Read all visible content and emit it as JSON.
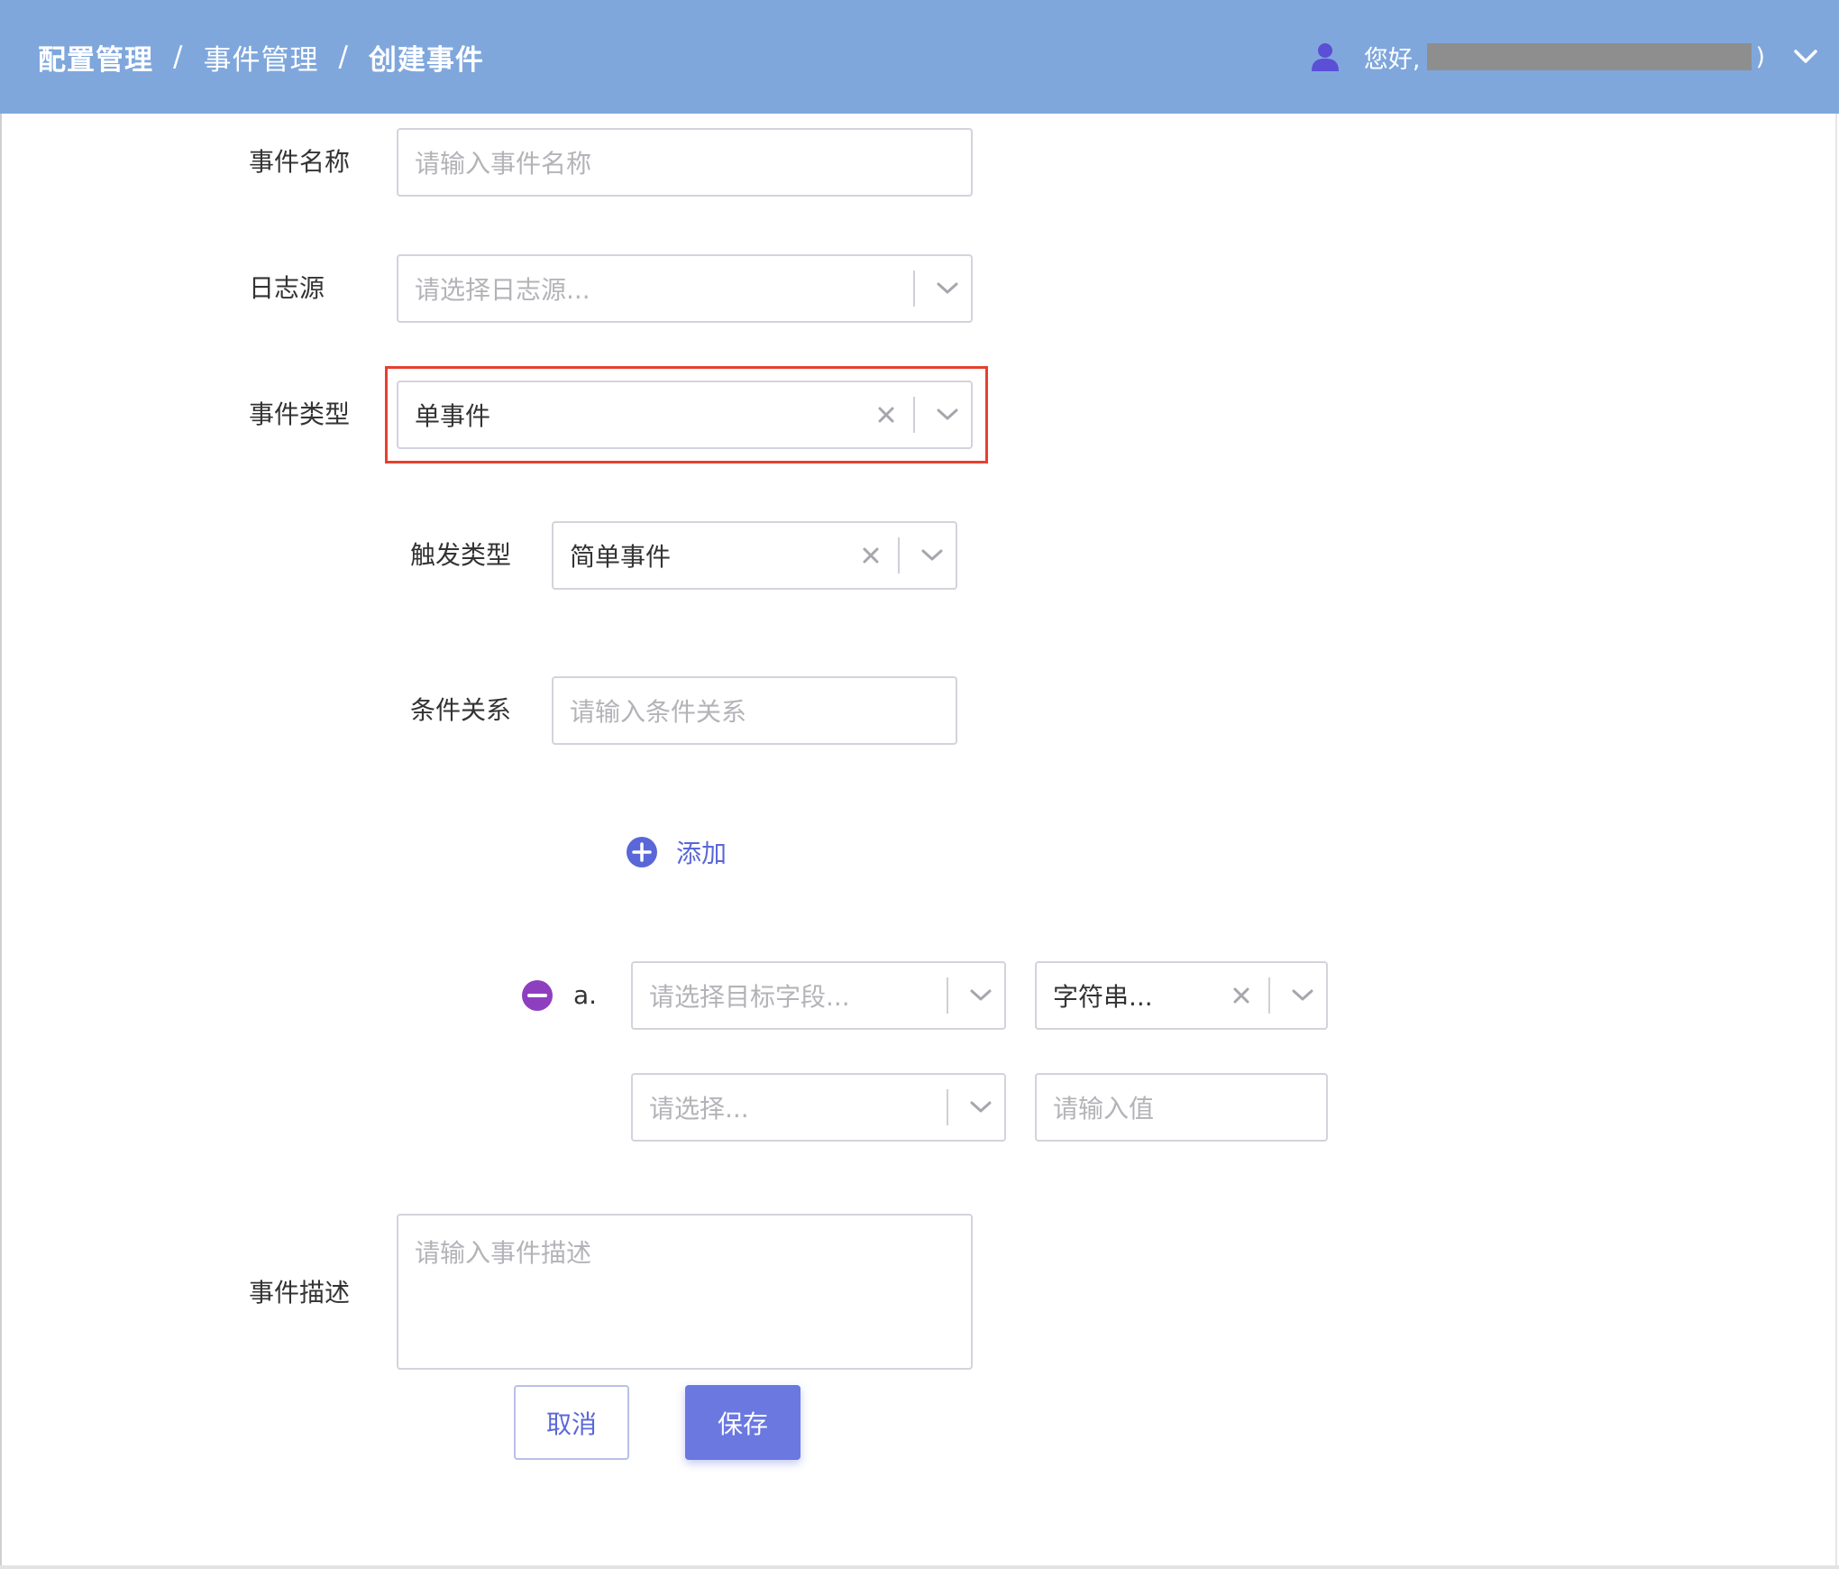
{
  "header": {
    "breadcrumb": [
      "配置管理",
      "事件管理",
      "创建事件"
    ],
    "separator": "/",
    "greeting": "您好,",
    "paren_close": ")",
    "user_icon": "user-icon",
    "menu_icon": "chevron-down-icon"
  },
  "form": {
    "event_name": {
      "label": "事件名称",
      "placeholder": "请输入事件名称"
    },
    "log_source": {
      "label": "日志源",
      "placeholder": "请选择日志源..."
    },
    "event_type": {
      "label": "事件类型",
      "value": "单事件"
    },
    "trigger_type": {
      "label": "触发类型",
      "value": "简单事件"
    },
    "condition_relation": {
      "label": "条件关系",
      "placeholder": "请输入条件关系"
    },
    "add_label": "添加",
    "condition": {
      "index": "a.",
      "target_field_placeholder": "请选择目标字段...",
      "data_type_value": "字符串...",
      "operator_placeholder": "请选择...",
      "value_placeholder": "请输入值"
    },
    "description": {
      "label": "事件描述",
      "placeholder": "请输入事件描述"
    }
  },
  "actions": {
    "cancel": "取消",
    "save": "保存"
  },
  "colors": {
    "header_bg": "#7fa7dc",
    "accent": "#5a67d8",
    "highlight": "#e6402f",
    "remove": "#8e3fbf"
  }
}
